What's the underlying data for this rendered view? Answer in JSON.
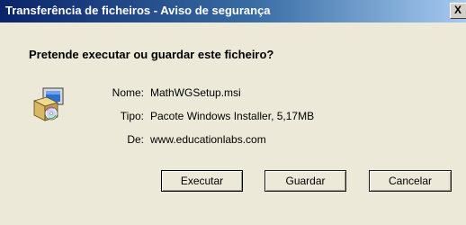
{
  "window": {
    "title": "Transferência de ficheiros - Aviso de segurança",
    "close_label": "X"
  },
  "dialog": {
    "heading": "Pretende executar ou guardar este ficheiro?",
    "icon": "installer-package-icon",
    "fields": {
      "name_label": "Nome:",
      "name_value": "MathWGSetup.msi",
      "type_label": "Tipo:",
      "type_value": "Pacote Windows Installer, 5,17MB",
      "from_label": "De:",
      "from_value": "www.educationlabs.com"
    }
  },
  "buttons": {
    "run": "Executar",
    "save": "Guardar",
    "cancel": "Cancelar"
  },
  "colors": {
    "titlebar_start": "#0a246a",
    "titlebar_end": "#a6caf0",
    "dialog_background": "#ece9d8"
  }
}
